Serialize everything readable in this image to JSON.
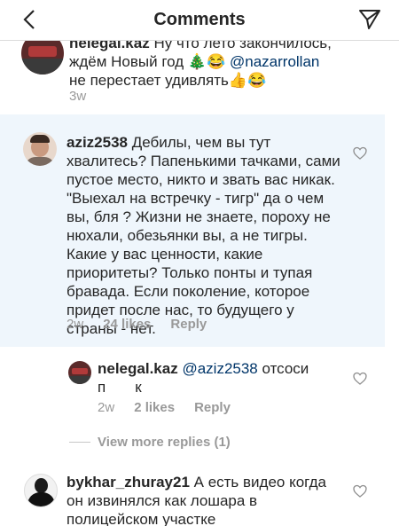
{
  "header": {
    "title": "Comments",
    "back_icon": "chevron-left-icon",
    "send_icon": "paper-plane-icon"
  },
  "comments": [
    {
      "username": "nelegal.kaz",
      "text_pre": " Ну что лето закончилось, ждём Новый год ",
      "emoji1": "🎄😂",
      "mention": "@nazarrollan",
      "text_post": " не перестает удивлять",
      "emoji2": "👍😂",
      "time": "3w"
    },
    {
      "username": "aziz2538",
      "text": "Дебилы, чем вы тут хвалитесь? Папенькими тачками, сами пустое место, никто и звать вас никак. \"Выехал на встречку - тигр\" да о чем вы, бля ? Жизни не знаете, пороху не нюхали, обезьянки вы, а не тигры. Какие у вас ценности, какие приоритеты? Только понты и тупая бравада. Если поколение, которое придет после нас, то будущего у страны - нет.",
      "time": "2w",
      "likes": "24 likes",
      "reply": "Reply"
    },
    {
      "username": "nelegal.kaz",
      "mention": "@aziz2538",
      "text_line1": " отсоси",
      "text_line2": "п       к",
      "time": "2w",
      "likes": "2 likes",
      "reply": "Reply"
    },
    {
      "username": "bykhar_zhuray21",
      "text": " А есть видео когда он извинялся как лошара в полицейском участке"
    }
  ],
  "view_more": "View more replies (1)",
  "colors": {
    "highlight_bg": "#eff6fc",
    "mention": "#003569",
    "meta": "#999999"
  }
}
